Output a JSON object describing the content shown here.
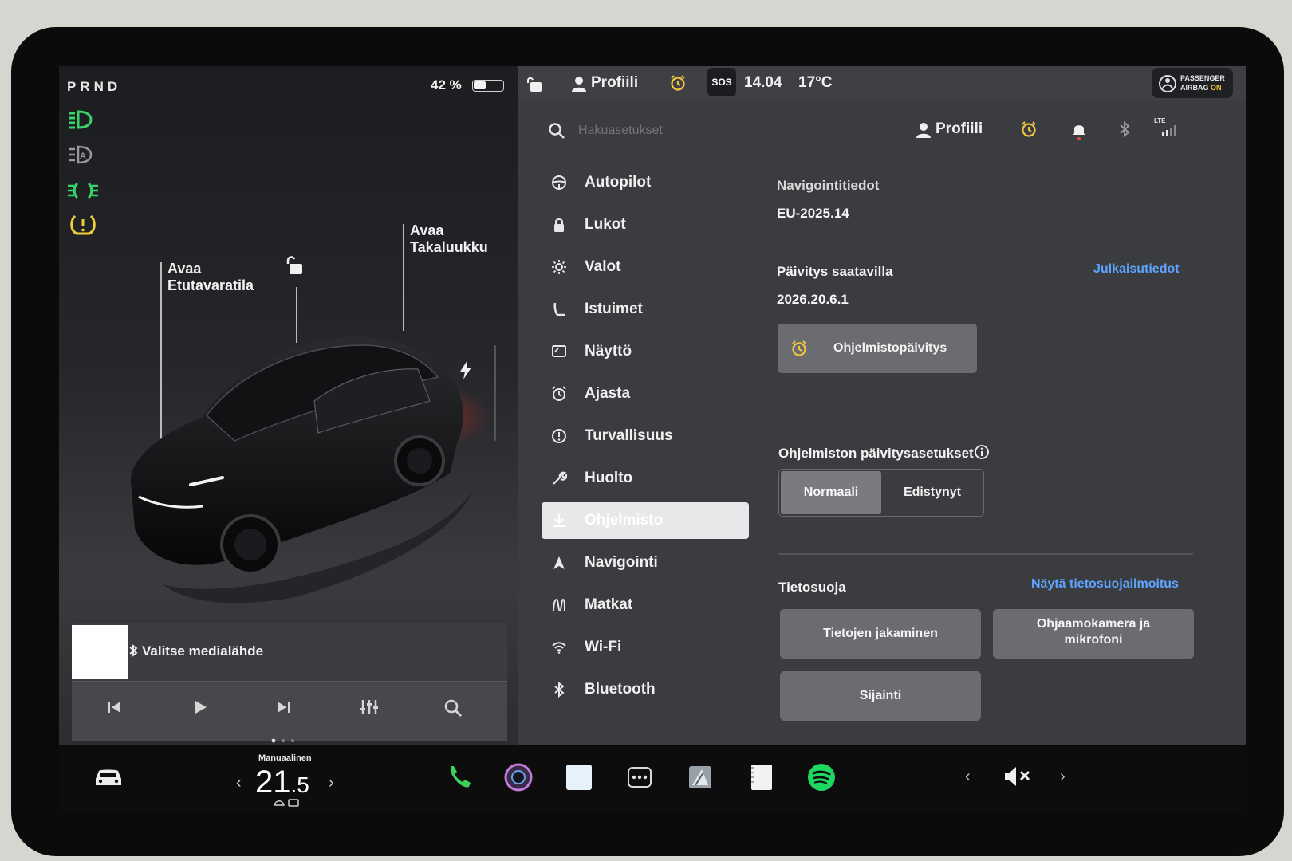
{
  "status": {
    "gear": "PRND",
    "battery_text": "42 %",
    "battery_level": 0.42
  },
  "car_labels": {
    "frunk": "Avaa\nEtutavaratila",
    "trunk": "Avaa\nTakaluukku"
  },
  "media": {
    "source_label": "Valitse medialähde"
  },
  "topbar": {
    "profile": "Profiili",
    "sos": "SOS",
    "time": "14.04",
    "temperature": "17°C",
    "airbag_line1": "PASSENGER",
    "airbag_line2_a": "AIRBAG",
    "airbag_line2_b": "ON"
  },
  "search": {
    "placeholder": "Hakuasetukset",
    "profile": "Profiili",
    "lte": "LTE"
  },
  "menu": {
    "items": [
      {
        "label": "Autopilot",
        "icon": "steering-wheel-icon"
      },
      {
        "label": "Lukot",
        "icon": "lock-icon"
      },
      {
        "label": "Valot",
        "icon": "sun-icon"
      },
      {
        "label": "Istuimet",
        "icon": "seat-icon"
      },
      {
        "label": "Näyttö",
        "icon": "display-icon"
      },
      {
        "label": "Ajasta",
        "icon": "alarm-clock-icon"
      },
      {
        "label": "Turvallisuus",
        "icon": "alert-circle-icon"
      },
      {
        "label": "Huolto",
        "icon": "wrench-icon"
      },
      {
        "label": "Ohjelmisto",
        "icon": "download-icon",
        "active": true
      },
      {
        "label": "Navigointi",
        "icon": "navigation-arrow-icon"
      },
      {
        "label": "Matkat",
        "icon": "trips-icon"
      },
      {
        "label": "Wi-Fi",
        "icon": "wifi-icon"
      },
      {
        "label": "Bluetooth",
        "icon": "bluetooth-icon"
      }
    ]
  },
  "software": {
    "nav_heading": "Navigointitiedot",
    "nav_version": "EU-2025.14",
    "update_heading": "Päivitys saatavilla",
    "release_notes": "Julkaisutiedot",
    "update_version": "2026.20.6.1",
    "update_button": "Ohjelmistopäivitys",
    "pref_heading": "Ohjelmiston päivitysasetukset",
    "pref_options": [
      "Normaali",
      "Edistynyt"
    ],
    "pref_selected": "Normaali",
    "privacy_heading": "Tietosuoja",
    "privacy_link": "Näytä tietosuojailmoitus",
    "privacy_buttons": [
      "Tietojen jakaminen",
      "Ohjaamokamera ja mikrofoni",
      "Sijainti"
    ]
  },
  "dock": {
    "climate_mode": "Manuaalinen",
    "temp_whole": "21",
    "temp_decimal": ".5",
    "page_dots": 3,
    "colors": {
      "phone": "#3ecf5a",
      "spotify": "#1ed760",
      "link": "#5ea4ff",
      "alarm": "#f4c542"
    }
  }
}
